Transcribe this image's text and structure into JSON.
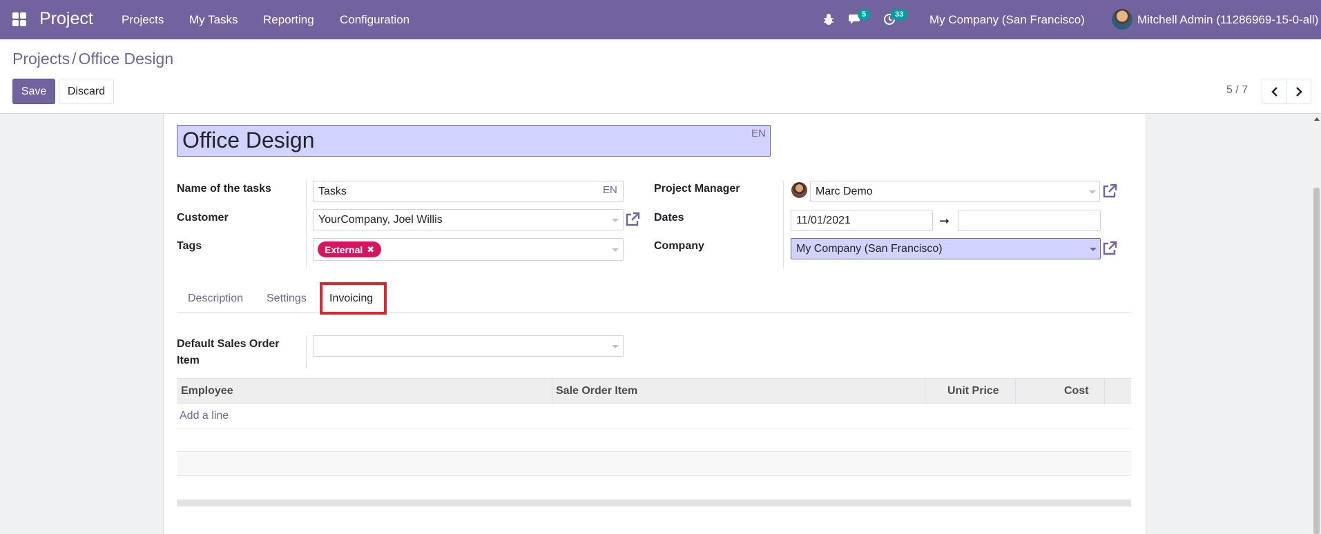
{
  "navbar": {
    "brand": "Project",
    "menu": [
      "Projects",
      "My Tasks",
      "Reporting",
      "Configuration"
    ],
    "messages_badge": "5",
    "activities_badge": "33",
    "company": "My Company (San Francisco)",
    "user": "Mitchell Admin (11286969-15-0-all)"
  },
  "breadcrumb": {
    "parent": "Projects",
    "separator": "/",
    "current": "Office Design"
  },
  "buttons": {
    "save": "Save",
    "discard": "Discard"
  },
  "pager": {
    "value": "5 / 7"
  },
  "form": {
    "title": "Office Design",
    "lang": "EN",
    "name_of_tasks_label": "Name of the tasks",
    "name_of_tasks_value": "Tasks",
    "customer_label": "Customer",
    "customer_value": "YourCompany, Joel Willis",
    "tags_label": "Tags",
    "tag": "External",
    "project_manager_label": "Project Manager",
    "project_manager_value": "Marc Demo",
    "dates_label": "Dates",
    "date_start": "11/01/2021",
    "date_end": "",
    "company_label": "Company",
    "company_value": "My Company (San Francisco)"
  },
  "tabs": [
    "Description",
    "Settings",
    "Invoicing"
  ],
  "invoicing": {
    "default_so_item_label_line1": "Default Sales Order",
    "default_so_item_label_line2": "Item",
    "default_so_item_value": "",
    "columns": [
      "Employee",
      "Sale Order Item",
      "Unit Price",
      "Cost"
    ],
    "add_line": "Add a line"
  },
  "colors": {
    "brand": "#71639e",
    "tag": "#d6145f",
    "highlight_box": "#e0262b"
  }
}
